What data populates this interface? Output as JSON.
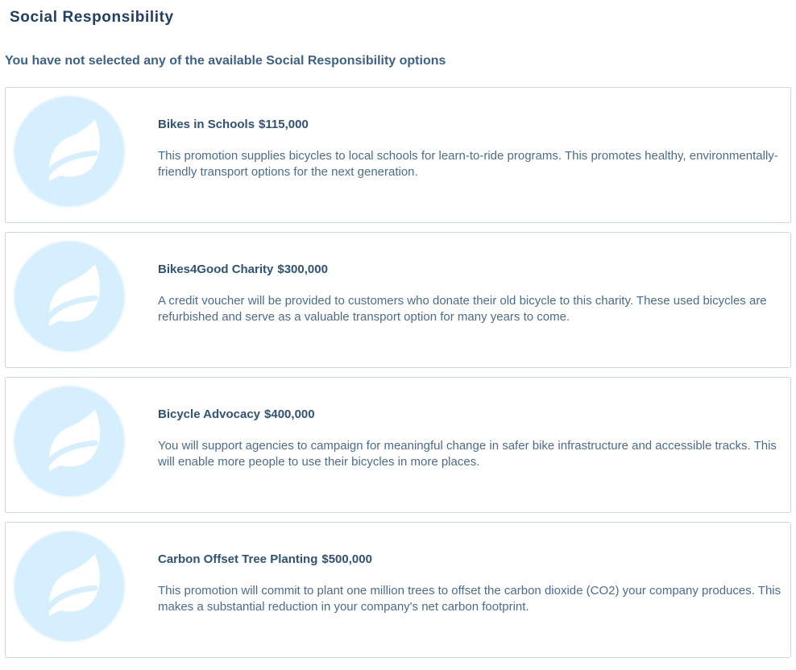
{
  "page": {
    "title": "Social Responsibility",
    "status_message": "You have not selected any of the available Social Responsibility options"
  },
  "colors": {
    "title": "#1f3f66",
    "heading": "#2e5278",
    "body_text": "#4a6c8f",
    "icon_fill": "#d6efff",
    "icon_ring": "#e9f6ff",
    "card_border": "#cfd5dc"
  },
  "options": [
    {
      "icon": "leaf-icon",
      "name": "Bikes in Schools",
      "price": "$115,000",
      "description": "This promotion supplies bicycles to local schools for learn-to-ride programs. This promotes healthy, environmentally-friendly transport options for the next generation."
    },
    {
      "icon": "leaf-icon",
      "name": "Bikes4Good Charity",
      "price": "$300,000",
      "description": "A credit voucher will be provided to customers who donate their old bicycle to this charity. These used bicycles are refurbished and serve as a valuable transport option for many years to come."
    },
    {
      "icon": "leaf-icon",
      "name": "Bicycle Advocacy",
      "price": "$400,000",
      "description": "You will support agencies to campaign for meaningful change in safer bike infrastructure and accessible tracks. This will enable more people to use their bicycles in more places."
    },
    {
      "icon": "leaf-icon",
      "name": "Carbon Offset Tree Planting",
      "price": "$500,000",
      "description": "This promotion will commit to plant one million trees to offset the carbon dioxide (CO2) your company produces. This makes a substantial reduction in your company's net carbon footprint."
    }
  ]
}
